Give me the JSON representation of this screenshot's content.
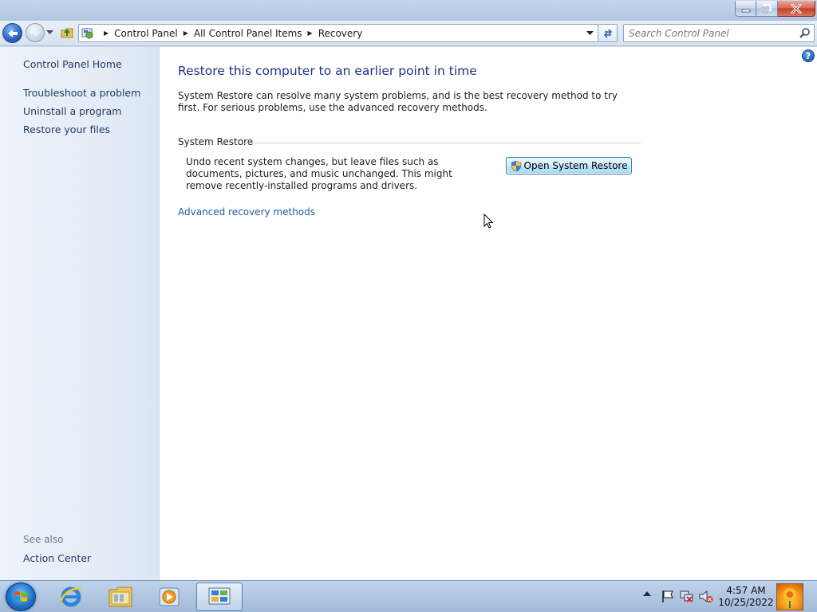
{
  "window": {
    "minimize_glyph": "—",
    "maximize_glyph": "❐",
    "close_glyph": "✕"
  },
  "address": {
    "breadcrumbs": [
      "Control Panel",
      "All Control Panel Items",
      "Recovery"
    ]
  },
  "search": {
    "placeholder": "Search Control Panel"
  },
  "sidebar": {
    "home": "Control Panel Home",
    "links": [
      "Troubleshoot a problem",
      "Uninstall a program",
      "Restore your files"
    ],
    "see_also_label": "See also",
    "see_also_links": [
      "Action Center"
    ]
  },
  "main": {
    "title": "Restore this computer to an earlier point in time",
    "intro": "System Restore can resolve many system problems, and is the best recovery method to try first. For serious problems, use the advanced recovery methods.",
    "section_title": "System Restore",
    "section_desc": "Undo recent system changes, but leave files such as documents, pictures, and music unchanged. This might remove recently-installed programs and drivers.",
    "button_label": "Open System Restore",
    "advanced_link": "Advanced recovery methods",
    "help_glyph": "?"
  },
  "taskbar": {
    "pinned": [
      "start-orb",
      "internet-explorer-icon",
      "windows-explorer-icon",
      "media-player-icon",
      "control-panel-icon"
    ],
    "active": "control-panel-icon"
  },
  "clock": {
    "time": "4:57 AM",
    "date": "10/25/2022"
  }
}
